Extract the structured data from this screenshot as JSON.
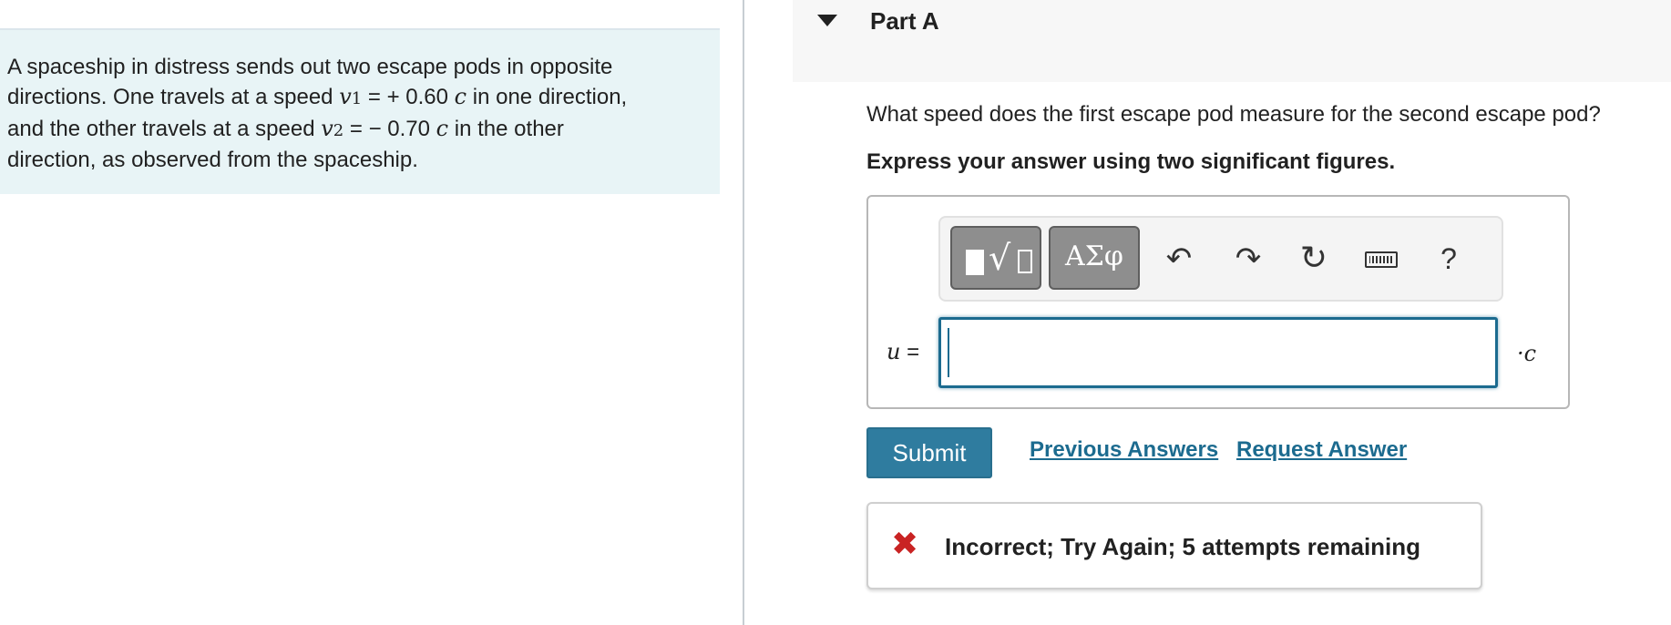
{
  "problem": {
    "line1": "A spaceship in distress sends out two escape pods in opposite",
    "line2_a": "directions. One travels at a speed ",
    "v1_sym": "v",
    "v1_sub": "1",
    "v1_eq": " = + 0.60 ",
    "c1": "c",
    "line2_b": " in one direction,",
    "line3_a": "and the other travels at a speed ",
    "v2_sym": "v",
    "v2_sub": "2",
    "v2_eq": " = − 0.70 ",
    "c2": "c",
    "line3_b": " in the other",
    "line4": "direction, as observed from the spaceship."
  },
  "part": {
    "title": "Part A"
  },
  "question": "What speed does the first escape pod measure for the second escape pod?",
  "instruction": "Express your answer using two significant figures.",
  "toolbar": {
    "greek_label": "ΑΣφ",
    "undo_glyph": "↶",
    "redo_glyph": "↷",
    "reset_glyph": "↻",
    "help_label": "?",
    "icons": [
      "templates-icon",
      "greek-letters-icon",
      "undo-icon",
      "redo-icon",
      "reset-icon",
      "keyboard-icon",
      "help-icon"
    ]
  },
  "answer": {
    "var": "u",
    "eq": " =",
    "value": "",
    "unit": "·c"
  },
  "actions": {
    "submit_label": "Submit",
    "previous_label": "Previous Answers",
    "request_label": "Request Answer"
  },
  "feedback": {
    "icon_glyph": "✖",
    "text": "Incorrect; Try Again; 5 attempts remaining",
    "color": "#c92323"
  },
  "colors": {
    "accent": "#2f7c9f",
    "problem_bg": "#e8f4f6"
  }
}
